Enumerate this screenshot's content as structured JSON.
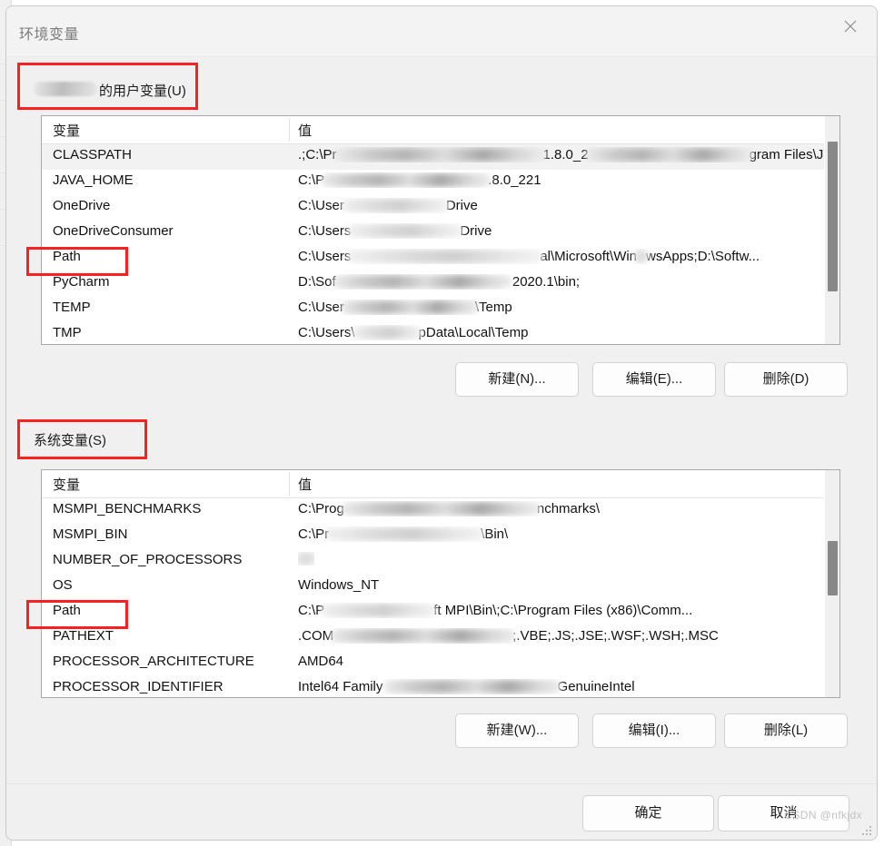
{
  "window": {
    "title": "环境变量",
    "close_icon": "close-icon"
  },
  "user_section": {
    "label_suffix": "的用户变量(U)",
    "username_redacted": true,
    "columns": [
      "变量",
      "值"
    ],
    "rows": [
      {
        "name": "CLASSPATH",
        "value_prefix": ".;C:\\Pr",
        "value_suffix": "gram Files\\Jav...",
        "selected": true
      },
      {
        "name": "JAVA_HOME",
        "value_prefix": "C:\\P",
        "value_suffix": ".8.0_221",
        "selected": false
      },
      {
        "name": "OneDrive",
        "value_prefix": "C:\\User",
        "value_suffix": "Drive",
        "selected": false
      },
      {
        "name": "OneDriveConsumer",
        "value_prefix": "C:\\Users",
        "value_suffix": "Drive",
        "selected": false
      },
      {
        "name": "Path",
        "value_prefix": "C:\\Users",
        "value_suffix": "wsApps;D:\\Softw...",
        "selected": false
      },
      {
        "name": "PyCharm",
        "value_prefix": "D:\\Sof",
        "value_suffix": " 2020.1\\bin;",
        "selected": false
      },
      {
        "name": "TEMP",
        "value_prefix": "C:\\User",
        "value_suffix": "\\Temp",
        "selected": false
      },
      {
        "name": "TMP",
        "value_prefix": "C:\\Users\\",
        "value_suffix": "pData\\Local\\Temp",
        "selected": false
      }
    ],
    "buttons": {
      "new": "新建(N)...",
      "edit": "编辑(E)...",
      "delete": "删除(D)"
    }
  },
  "system_section": {
    "label": "系统变量(S)",
    "columns": [
      "变量",
      "值"
    ],
    "rows": [
      {
        "name": "MSMPI_BENCHMARKS",
        "value_prefix": "C:\\Prog",
        "value_suffix": "nchmarks\\",
        "selected": false
      },
      {
        "name": "MSMPI_BIN",
        "value_prefix": "C:\\Pr",
        "value_suffix": "\\Bin\\",
        "selected": false
      },
      {
        "name": "NUMBER_OF_PROCESSORS",
        "value_prefix": "",
        "value_suffix": "",
        "selected": false
      },
      {
        "name": "OS",
        "value_prefix": "Windows_NT",
        "value_suffix": "",
        "selected": false
      },
      {
        "name": "Path",
        "value_prefix": "C:\\P",
        "value_suffix": "ft MPI\\Bin\\;C:\\Program Files (x86)\\Comm...",
        "selected": false
      },
      {
        "name": "PATHEXT",
        "value_prefix": ".COM",
        "value_suffix": ";.VBE;.JS;.JSE;.WSF;.WSH;.MSC",
        "selected": false
      },
      {
        "name": "PROCESSOR_ARCHITECTURE",
        "value_prefix": "AMD64",
        "value_suffix": "",
        "selected": false
      },
      {
        "name": "PROCESSOR_IDENTIFIER",
        "value_prefix": "Intel64 Family ",
        "value_suffix": "GenuineIntel",
        "selected": false
      }
    ],
    "buttons": {
      "new": "新建(W)...",
      "edit": "编辑(I)...",
      "delete": "删除(L)"
    }
  },
  "footer": {
    "ok": "确定",
    "cancel": "取消"
  },
  "watermark": "CSDN @nfkjdx",
  "annotations": {
    "accent_color": "#fc2020",
    "boxes": [
      "user-variables-label-box",
      "user-path-row-box",
      "system-variables-label-box",
      "system-path-row-box"
    ]
  }
}
